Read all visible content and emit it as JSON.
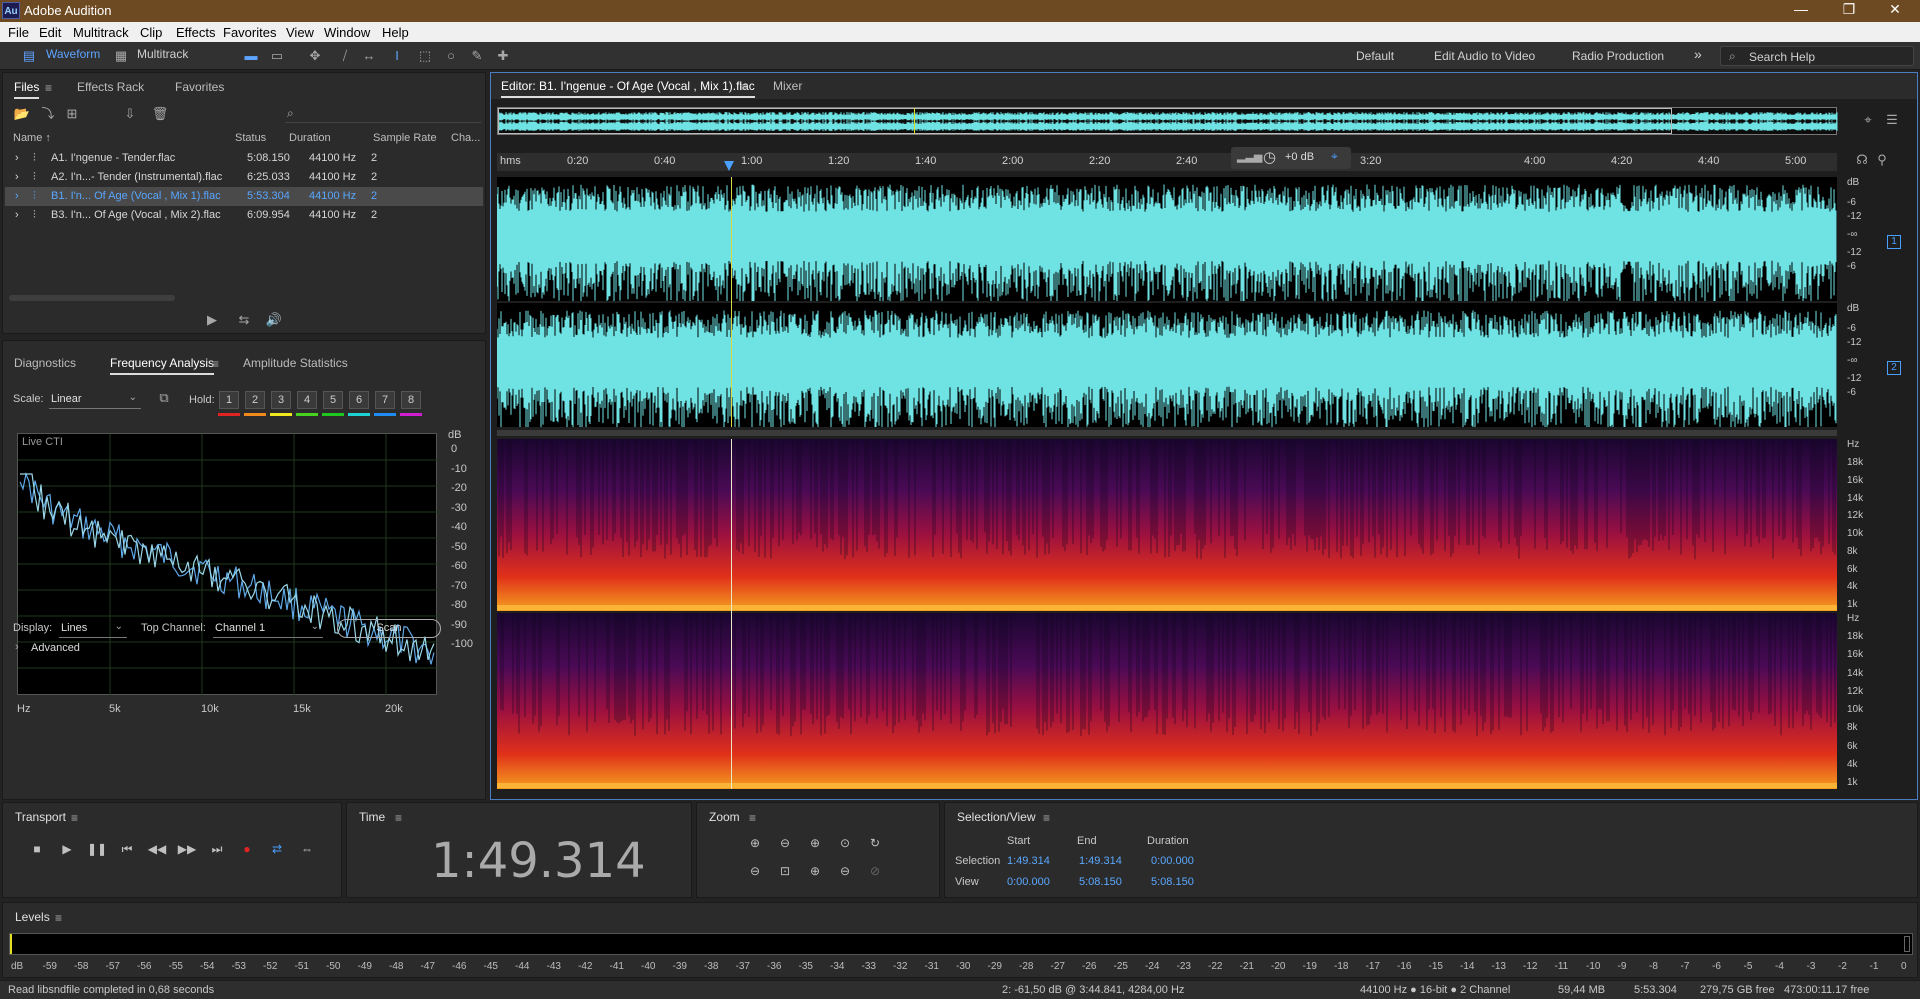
{
  "titlebar": {
    "logo": "Au",
    "title": "Adobe Audition",
    "min": "—",
    "max": "❐",
    "close": "✕"
  },
  "menu": [
    "File",
    "Edit",
    "Multitrack",
    "Clip",
    "Effects",
    "Favorites",
    "View",
    "Window",
    "Help"
  ],
  "toolbar": {
    "waveform": "Waveform",
    "multitrack": "Multitrack",
    "workspaces": [
      "Default",
      "Edit Audio to Video",
      "Radio Production"
    ],
    "more": "»",
    "search_placeholder": "Search Help"
  },
  "files_panel": {
    "tabs": [
      "Files",
      "Effects Rack",
      "Favorites"
    ],
    "columns": [
      "Name ↑",
      "Status",
      "Duration",
      "Sample Rate",
      "Cha..."
    ],
    "rows": [
      {
        "name": "A1. I'ngenue - Tender.flac",
        "duration": "5:08.150",
        "rate": "44100 Hz",
        "channels": "2",
        "selected": false
      },
      {
        "name": "A2. I'n...- Tender (Instrumental).flac",
        "duration": "6:25.033",
        "rate": "44100 Hz",
        "channels": "2",
        "selected": false
      },
      {
        "name": "B1. I'n... Of Age (Vocal , Mix 1).flac",
        "duration": "5:53.304",
        "rate": "44100 Hz",
        "channels": "2",
        "selected": true
      },
      {
        "name": "B3. I'n... Of Age (Vocal , Mix 2).flac",
        "duration": "6:09.954",
        "rate": "44100 Hz",
        "channels": "2",
        "selected": false
      }
    ]
  },
  "freq_panel": {
    "tabs": [
      "Diagnostics",
      "Frequency Analysis",
      "Amplitude Statistics"
    ],
    "scale_label": "Scale:",
    "scale_value": "Linear",
    "hold_label": "Hold:",
    "hold_buttons": [
      "1",
      "2",
      "3",
      "4",
      "5",
      "6",
      "7",
      "8"
    ],
    "hold_colors": [
      "#e02424",
      "#f08a1c",
      "#f0e81c",
      "#46d21e",
      "#1ec81e",
      "#1ed2d2",
      "#1e8cf0",
      "#d21ed2"
    ],
    "graph_label": "Live CTI",
    "db_label": "dB",
    "db_ticks": [
      "0",
      "-10",
      "-20",
      "-30",
      "-40",
      "-50",
      "-60",
      "-70",
      "-80",
      "-90",
      "-100"
    ],
    "x_ticks": [
      "Hz",
      "5k",
      "10k",
      "15k",
      "20k"
    ],
    "display_label": "Display:",
    "display_value": "Lines",
    "top_channel_label": "Top Channel:",
    "top_channel_value": "Channel 1",
    "scan": "Scan",
    "advanced": "Advanced"
  },
  "editor": {
    "tab": "Editor: B1. I'ngenue - Of Age (Vocal , Mix 1).flac",
    "mixer": "Mixer",
    "ruler_unit": "hms",
    "ruler_ticks": [
      "0:20",
      "0:40",
      "1:00",
      "1:20",
      "1:40",
      "2:00",
      "2:20",
      "2:40",
      "3:00",
      "3:20",
      "4:00",
      "4:20",
      "4:40",
      "5:00"
    ],
    "gain": "+0 dB",
    "db_scale_1": [
      "dB",
      "-6",
      "-12",
      "-∞",
      "-12",
      "-6"
    ],
    "db_scale_2": [
      "dB",
      "-6",
      "-12",
      "-∞",
      "-12",
      "-6"
    ],
    "channel_1": "1",
    "channel_2": "2",
    "hz_scale": [
      "Hz",
      "18k",
      "16k",
      "14k",
      "12k",
      "10k",
      "8k",
      "6k",
      "4k",
      "1k"
    ],
    "wave_color": "#6fe3e3"
  },
  "transport": {
    "title": "Transport"
  },
  "time": {
    "title": "Time",
    "value": "1:49.314"
  },
  "zoom": {
    "title": "Zoom"
  },
  "selection": {
    "title": "Selection/View",
    "headers": [
      "Start",
      "End",
      "Duration"
    ],
    "selection_label": "Selection",
    "selection": [
      "1:49.314",
      "1:49.314",
      "0:00.000"
    ],
    "view_label": "View",
    "view": [
      "0:00.000",
      "5:08.150",
      "5:08.150"
    ]
  },
  "levels": {
    "title": "Levels",
    "ticks": [
      "dB",
      "-59",
      "-58",
      "-57",
      "-56",
      "-55",
      "-54",
      "-53",
      "-52",
      "-51",
      "-50",
      "-49",
      "-48",
      "-47",
      "-46",
      "-45",
      "-44",
      "-43",
      "-42",
      "-41",
      "-40",
      "-39",
      "-38",
      "-37",
      "-36",
      "-35",
      "-34",
      "-33",
      "-32",
      "-31",
      "-30",
      "-29",
      "-28",
      "-27",
      "-26",
      "-25",
      "-24",
      "-23",
      "-22",
      "-21",
      "-20",
      "-19",
      "-18",
      "-17",
      "-16",
      "-15",
      "-14",
      "-13",
      "-12",
      "-11",
      "-10",
      "-9",
      "-8",
      "-7",
      "-6",
      "-5",
      "-4",
      "-3",
      "-2",
      "-1",
      "0"
    ]
  },
  "status": {
    "message": "Read libsndfile completed in 0,68 seconds",
    "cursor": "2: -61,50 dB @ 3:44.841, 4284,00 Hz",
    "format": "44100 Hz ● 16-bit ● 2 Channel",
    "size": "59,44 MB",
    "duration": "5:53.304",
    "free": "279,75 GB free",
    "free_time": "473:00:11.17 free"
  }
}
